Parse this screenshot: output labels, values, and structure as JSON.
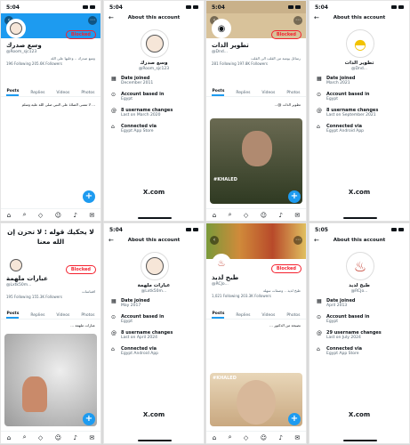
{
  "cells": [
    {
      "time": "5:04",
      "name": "وسع صدرك",
      "handle": "@Room_sjc123",
      "info": "وسع صدرك .. وخليها على الله",
      "stats": "196 Following  205.6K Followers",
      "blocked": "Blocked",
      "tabs": [
        "Posts",
        "Replies",
        "Videos",
        "Photos"
      ],
      "tweet": "... لا تنسى الصلاة على النبي صلى الله عليه وسلم"
    },
    {
      "time": "5:04",
      "title": "About this account",
      "name": "وسع صدرك",
      "handle": "@Room_sjc123",
      "rows": [
        {
          "t1": "Date joined",
          "t2": "December 2011"
        },
        {
          "t1": "Account based in",
          "t2": "Egypt"
        },
        {
          "t1": "8 username changes",
          "t2": "Last on March 2020"
        },
        {
          "t1": "Connected via",
          "t2": "Egypt App Store"
        }
      ],
      "brand": "X.com"
    },
    {
      "time": "5:04",
      "name": "تطوير الذات",
      "handle": "@Dnd...",
      "info": "رسائل يومية من القلب الى القلب",
      "stats": "281 Following  197.8K Followers",
      "blocked": "Blocked",
      "tabs": [
        "Posts",
        "Replies",
        "Videos",
        "Photos"
      ],
      "tweet": "تطوير الذات @...",
      "brand": "X.com",
      "caption": "#KHALED"
    },
    {
      "time": "5:04",
      "title": "About this account",
      "name": "تطوير الذات",
      "handle": "@Dnd...",
      "rows": [
        {
          "t1": "Date joined",
          "t2": "March 2021"
        },
        {
          "t1": "Account based in",
          "t2": "Egypt"
        },
        {
          "t1": "8 username changes",
          "t2": "Last on September 2021"
        },
        {
          "t1": "Connected via",
          "t2": "Egypt Android App"
        }
      ],
      "brand": "X.com"
    },
    {
      "time": "5:04",
      "banner": "لا يحكيك قوله : لا تحزن إن الله معنا",
      "name": "عبارات ملهمة",
      "handle": "@Lxtk50m...",
      "info": "اقتباسات",
      "stats": "195 Following  155.3K Followers",
      "blocked": "Blocked",
      "tabs": [
        "Posts",
        "Replies",
        "Videos",
        "Photos"
      ],
      "tweet": "عبارات ملهمة ..."
    },
    {
      "time": "5:04",
      "title": "About this account",
      "name": "عبارات ملهمة",
      "handle": "@Lxtk50m...",
      "rows": [
        {
          "t1": "Date joined",
          "t2": "May 2017"
        },
        {
          "t1": "Account based in",
          "t2": "Egypt"
        },
        {
          "t1": "8 username changes",
          "t2": "Last on April 2024"
        },
        {
          "t1": "Connected via",
          "t2": "Egypt Android App"
        }
      ],
      "brand": "X.com"
    },
    {
      "time": "5:04",
      "name": "طبخ لذيذ",
      "handle": "@RCJo...",
      "info": "طبخ لذيذ .. وصفات سهلة",
      "stats": "1,021 Following  203.3K Followers",
      "blocked": "Blocked",
      "tabs": [
        "Posts",
        "Replies",
        "Videos",
        "Photos"
      ],
      "tweet": "نصيحة من الدكتور ...",
      "caption": "#KHALED",
      "brand": "X.com"
    },
    {
      "time": "5:05",
      "title": "About this account",
      "name": "طبخ لذيذ",
      "handle": "@RCJo...",
      "rows": [
        {
          "t1": "Date joined",
          "t2": "April 2013"
        },
        {
          "t1": "Account based in",
          "t2": "Egypt"
        },
        {
          "t1": "29 username changes",
          "t2": "Last on July 2024"
        },
        {
          "t1": "Connected via",
          "t2": "Egypt App Store"
        }
      ],
      "brand": "X.com"
    }
  ]
}
